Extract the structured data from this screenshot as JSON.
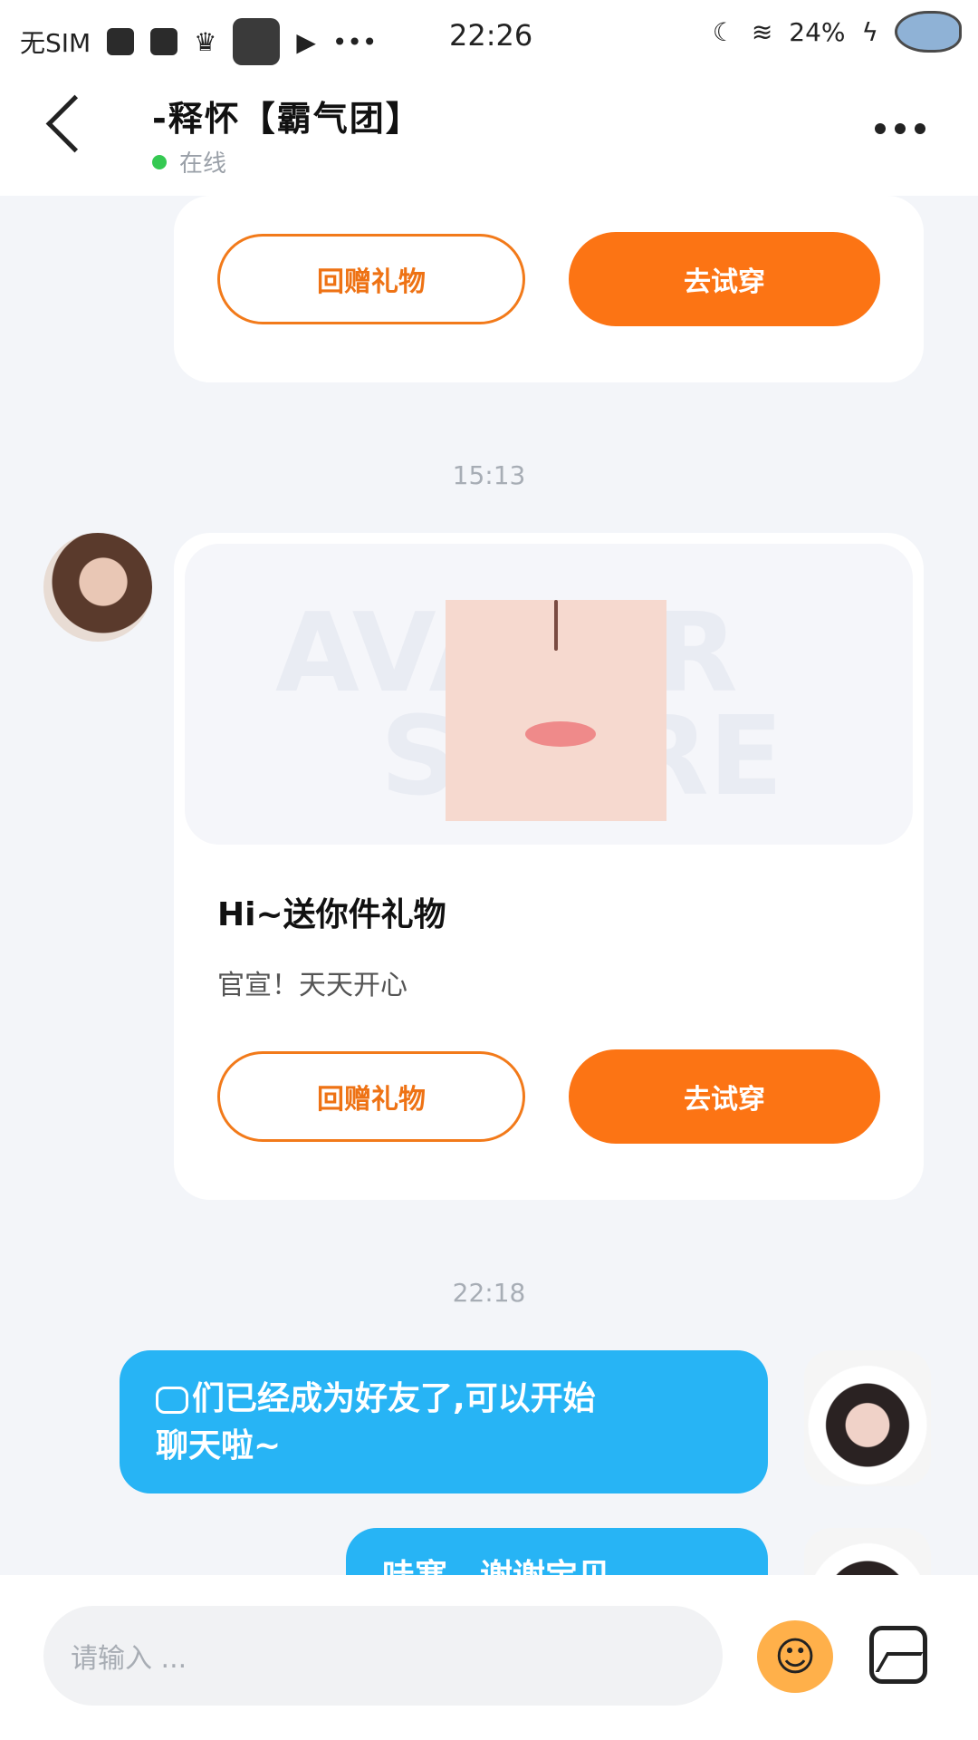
{
  "status_bar": {
    "carrier": "无SIM",
    "time": "22:26",
    "battery": "24%"
  },
  "header": {
    "title": "-释怀【霸气团】",
    "status": "在线"
  },
  "gift_card_1": {
    "return_gift": "回赠礼物",
    "try_on": "去试穿"
  },
  "timestamp_1": "15:13",
  "gift_card_2": {
    "watermark": "AVATAR STORE",
    "title": "Hi~送你件礼物",
    "subtitle": "官宣！天天开心",
    "return_gift": "回赠礼物",
    "try_on": "去试穿"
  },
  "timestamp_2": "22:18",
  "messages": [
    {
      "text_line1": "们已经成为好友了,可以开始",
      "text_line2": "聊天啦~"
    },
    {
      "text": "哇塞，谢谢宝贝"
    }
  ],
  "input": {
    "placeholder": "请输入 ..."
  },
  "colors": {
    "accent": "#fc7414",
    "bubble": "#27b4f5",
    "online": "#35c952"
  }
}
